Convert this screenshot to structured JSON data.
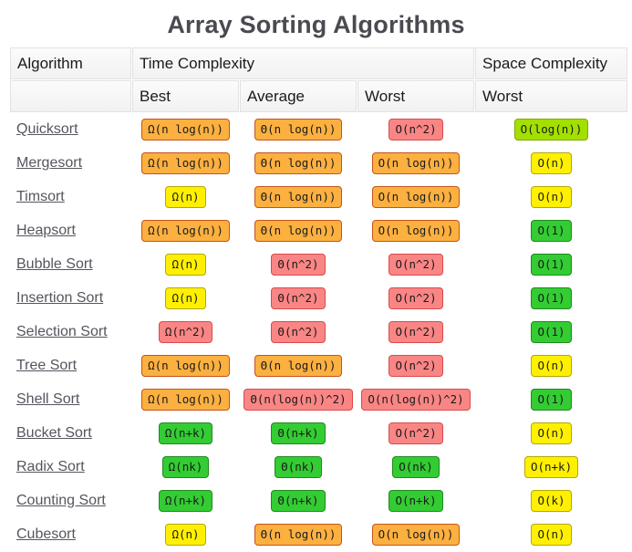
{
  "title": "Array Sorting Algorithms",
  "header": {
    "algorithm": "Algorithm",
    "time_complexity": "Time Complexity",
    "space_complexity": "Space Complexity",
    "blank": "",
    "best": "Best",
    "average": "Average",
    "worst": "Worst",
    "space_worst": "Worst"
  },
  "colors": {
    "green": "#33cc33",
    "chartreuse": "#a3e000",
    "yellow": "#fff000",
    "orange": "#fbb040",
    "red": "#fa8585",
    "title": "#4a4a52",
    "link": "#55555e"
  },
  "rows": [
    {
      "name": "Quicksort",
      "best": {
        "text": "Ω(n log(n))",
        "color": "orange"
      },
      "average": {
        "text": "Θ(n log(n))",
        "color": "orange"
      },
      "worst": {
        "text": "O(n^2)",
        "color": "red"
      },
      "space": {
        "text": "O(log(n))",
        "color": "chartreuse"
      }
    },
    {
      "name": "Mergesort",
      "best": {
        "text": "Ω(n log(n))",
        "color": "orange"
      },
      "average": {
        "text": "Θ(n log(n))",
        "color": "orange"
      },
      "worst": {
        "text": "O(n log(n))",
        "color": "orange"
      },
      "space": {
        "text": "O(n)",
        "color": "yellow"
      }
    },
    {
      "name": "Timsort",
      "best": {
        "text": "Ω(n)",
        "color": "yellow"
      },
      "average": {
        "text": "Θ(n log(n))",
        "color": "orange"
      },
      "worst": {
        "text": "O(n log(n))",
        "color": "orange"
      },
      "space": {
        "text": "O(n)",
        "color": "yellow"
      }
    },
    {
      "name": "Heapsort",
      "best": {
        "text": "Ω(n log(n))",
        "color": "orange"
      },
      "average": {
        "text": "Θ(n log(n))",
        "color": "orange"
      },
      "worst": {
        "text": "O(n log(n))",
        "color": "orange"
      },
      "space": {
        "text": "O(1)",
        "color": "green"
      }
    },
    {
      "name": "Bubble Sort",
      "best": {
        "text": "Ω(n)",
        "color": "yellow"
      },
      "average": {
        "text": "Θ(n^2)",
        "color": "red"
      },
      "worst": {
        "text": "O(n^2)",
        "color": "red"
      },
      "space": {
        "text": "O(1)",
        "color": "green"
      }
    },
    {
      "name": "Insertion Sort",
      "best": {
        "text": "Ω(n)",
        "color": "yellow"
      },
      "average": {
        "text": "Θ(n^2)",
        "color": "red"
      },
      "worst": {
        "text": "O(n^2)",
        "color": "red"
      },
      "space": {
        "text": "O(1)",
        "color": "green"
      }
    },
    {
      "name": "Selection Sort",
      "best": {
        "text": "Ω(n^2)",
        "color": "red"
      },
      "average": {
        "text": "Θ(n^2)",
        "color": "red"
      },
      "worst": {
        "text": "O(n^2)",
        "color": "red"
      },
      "space": {
        "text": "O(1)",
        "color": "green"
      }
    },
    {
      "name": "Tree Sort",
      "best": {
        "text": "Ω(n log(n))",
        "color": "orange"
      },
      "average": {
        "text": "Θ(n log(n))",
        "color": "orange"
      },
      "worst": {
        "text": "O(n^2)",
        "color": "red"
      },
      "space": {
        "text": "O(n)",
        "color": "yellow"
      }
    },
    {
      "name": "Shell Sort",
      "best": {
        "text": "Ω(n log(n))",
        "color": "orange"
      },
      "average": {
        "text": "Θ(n(log(n))^2)",
        "color": "red"
      },
      "worst": {
        "text": "O(n(log(n))^2)",
        "color": "red"
      },
      "space": {
        "text": "O(1)",
        "color": "green"
      }
    },
    {
      "name": "Bucket Sort",
      "best": {
        "text": "Ω(n+k)",
        "color": "green"
      },
      "average": {
        "text": "Θ(n+k)",
        "color": "green"
      },
      "worst": {
        "text": "O(n^2)",
        "color": "red"
      },
      "space": {
        "text": "O(n)",
        "color": "yellow"
      }
    },
    {
      "name": "Radix Sort",
      "best": {
        "text": "Ω(nk)",
        "color": "green"
      },
      "average": {
        "text": "Θ(nk)",
        "color": "green"
      },
      "worst": {
        "text": "O(nk)",
        "color": "green"
      },
      "space": {
        "text": "O(n+k)",
        "color": "yellow"
      }
    },
    {
      "name": "Counting Sort",
      "best": {
        "text": "Ω(n+k)",
        "color": "green"
      },
      "average": {
        "text": "Θ(n+k)",
        "color": "green"
      },
      "worst": {
        "text": "O(n+k)",
        "color": "green"
      },
      "space": {
        "text": "O(k)",
        "color": "yellow"
      }
    },
    {
      "name": "Cubesort",
      "best": {
        "text": "Ω(n)",
        "color": "yellow"
      },
      "average": {
        "text": "Θ(n log(n))",
        "color": "orange"
      },
      "worst": {
        "text": "O(n log(n))",
        "color": "orange"
      },
      "space": {
        "text": "O(n)",
        "color": "yellow"
      }
    }
  ]
}
